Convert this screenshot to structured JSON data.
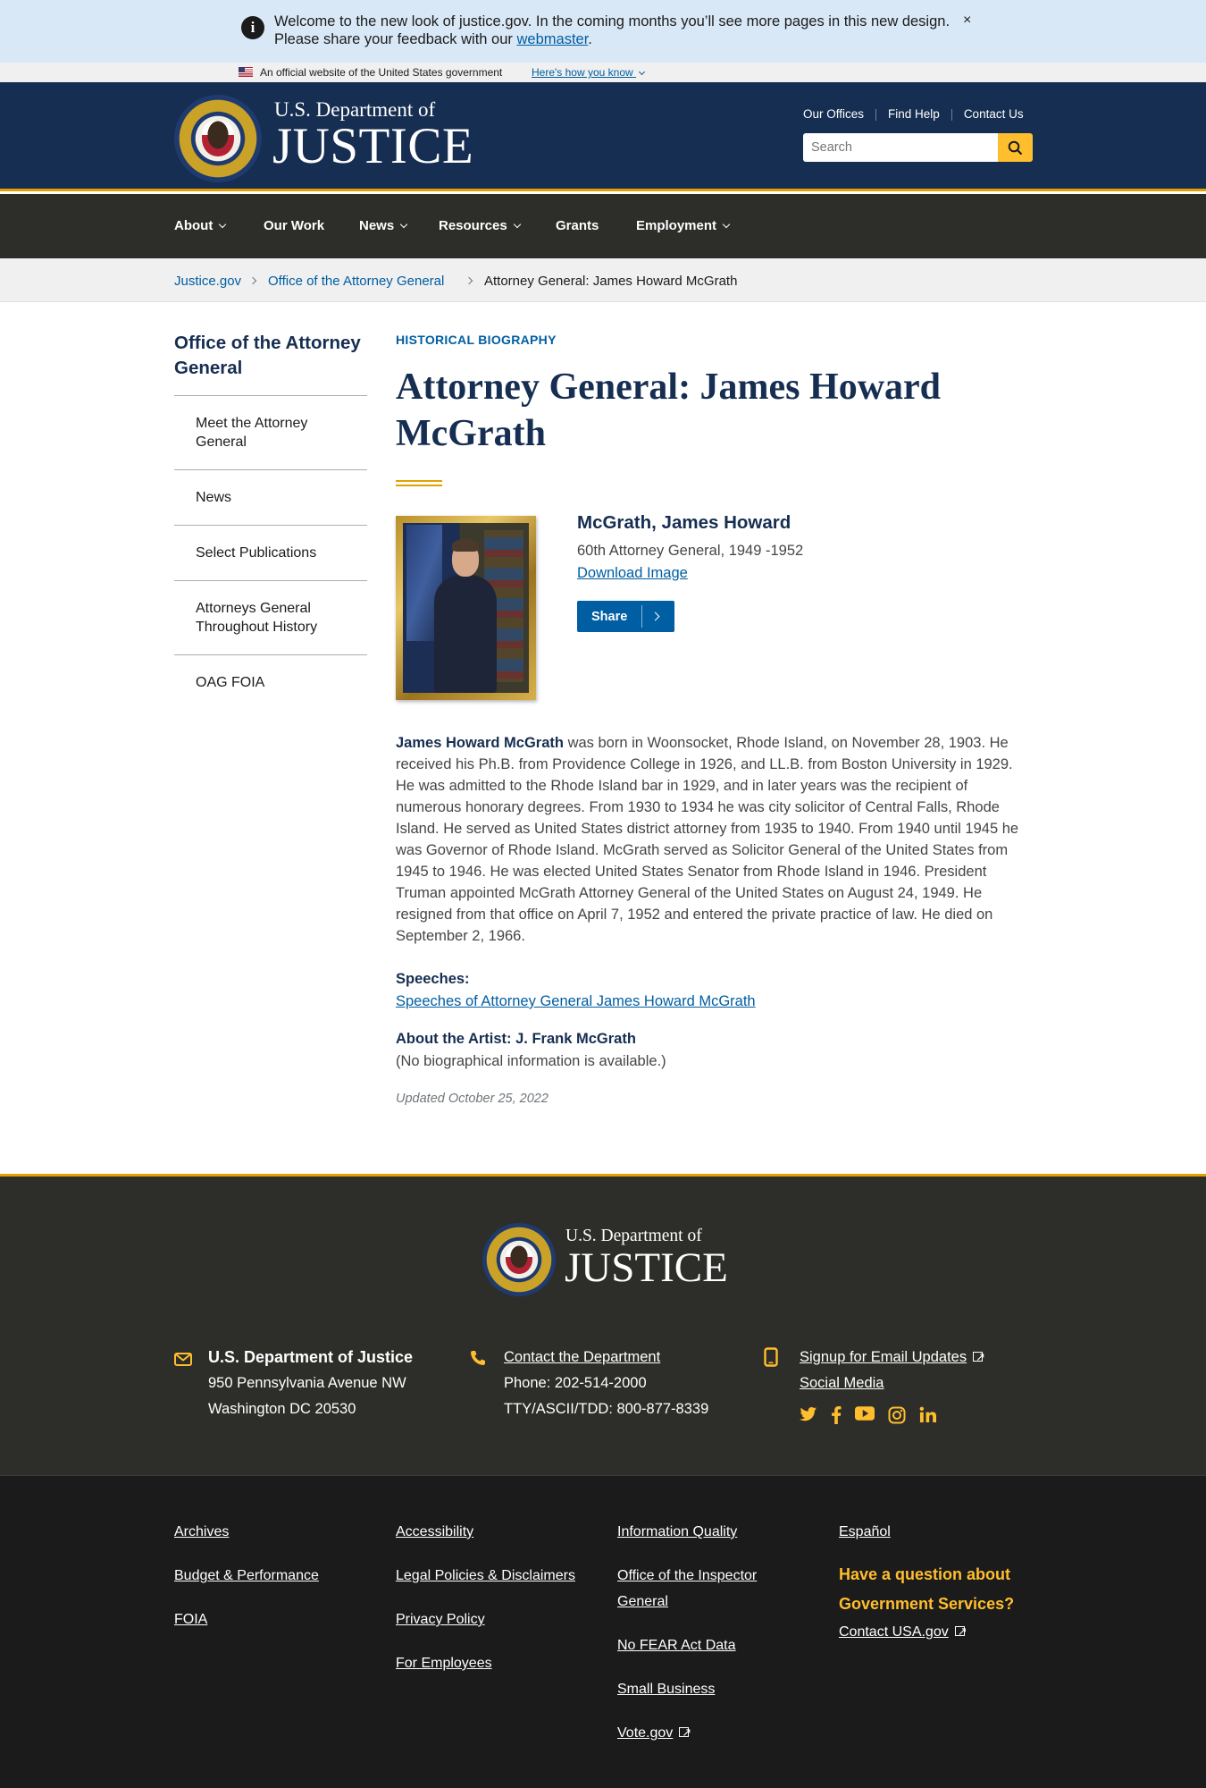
{
  "alert": {
    "text": "Welcome to the new look of justice.gov. In the coming months you’ll see more pages in this new design. Please share your feedback with our ",
    "link": "webmaster",
    "end": ".",
    "close": "×"
  },
  "official_banner": {
    "text": "An official website of the United States government",
    "link": "Here's how you know"
  },
  "header": {
    "brand_top": "U.S. Department of",
    "brand_main": "JUSTICE",
    "utility_links": [
      "Our Offices",
      "Find Help",
      "Contact Us"
    ],
    "search_placeholder": "Search"
  },
  "nav": {
    "items": [
      {
        "label": "About",
        "dropdown": true
      },
      {
        "label": "Our Work",
        "dropdown": false
      },
      {
        "label": "News",
        "dropdown": true
      },
      {
        "label": "Resources",
        "dropdown": true
      },
      {
        "label": "Grants",
        "dropdown": false
      },
      {
        "label": "Employment",
        "dropdown": true
      }
    ]
  },
  "breadcrumb": [
    "Justice.gov",
    "Office of the Attorney General",
    "Attorney General: James Howard McGrath"
  ],
  "sidenav": {
    "title": "Office of the Attorney General",
    "items": [
      "Meet the Attorney General",
      "News",
      "Select Publications",
      "Attorneys General Throughout History",
      "OAG FOIA"
    ]
  },
  "main": {
    "kicker": "HISTORICAL BIOGRAPHY",
    "title": "Attorney General: James Howard McGrath",
    "bio_name": "McGrath, James Howard",
    "bio_term": "60th Attorney General, 1949 -1952",
    "download": "Download Image",
    "share": "Share",
    "para_lead": "James Howard McGrath",
    "para_body": " was born in Woonsocket, Rhode Island, on November 28, 1903. He received his Ph.B. from Providence College in 1926, and LL.B. from Boston University in 1929. He was admitted to the Rhode Island bar in 1929, and in later years was the recipient of numerous honorary degrees. From 1930 to 1934 he was city solicitor of Central Falls, Rhode Island. He served as United States district attorney from 1935 to 1940. From 1940 until 1945 he was Governor of Rhode Island. McGrath served as Solicitor General of the United States from 1945 to 1946. He was elected United States Senator from Rhode Island in 1946. President Truman appointed McGrath Attorney General of the United States on August 24, 1949. He resigned from that office on April 7, 1952 and entered the private practice of law. He died on September 2, 1966.",
    "speeches_head": "Speeches:",
    "speeches_link": "Speeches of Attorney General James Howard McGrath",
    "artist_head": "About the Artist: J. Frank McGrath",
    "artist_text": "(No biographical information is available.)",
    "updated": "Updated October 25, 2022"
  },
  "footer": {
    "brand_top": "U.S. Department of",
    "brand_main": "JUSTICE",
    "address_title": "U.S. Department of Justice",
    "address_line1": "950 Pennsylvania Avenue NW",
    "address_line2": "Washington DC 20530",
    "contact_link": "Contact the Department",
    "phone": "Phone: 202-514-2000",
    "tty": "TTY/ASCII/TDD: 800-877-8339",
    "signup": "Signup for Email Updates",
    "social_media": "Social Media",
    "social_icons": [
      "twitter-icon",
      "facebook-icon",
      "youtube-icon",
      "instagram-icon",
      "linkedin-icon"
    ]
  },
  "footer_links": {
    "col1": [
      "Archives",
      "Budget & Performance",
      "FOIA"
    ],
    "col2": [
      "Accessibility",
      "Legal Policies & Disclaimers",
      "Privacy Policy",
      "For Employees"
    ],
    "col3": [
      "Information Quality",
      "Office of the Inspector General",
      "No FEAR Act Data",
      "Small Business",
      "Vote.gov"
    ],
    "col4_link": "Español",
    "question": "Have a question about Government Services?",
    "usa_link": "Contact USA.gov"
  },
  "colors": {
    "navy": "#162e51",
    "gold": "#e5a000",
    "link_blue": "#005ea2",
    "nav_dark": "#2d2e2a",
    "alert_bg": "#d9e8f6"
  }
}
